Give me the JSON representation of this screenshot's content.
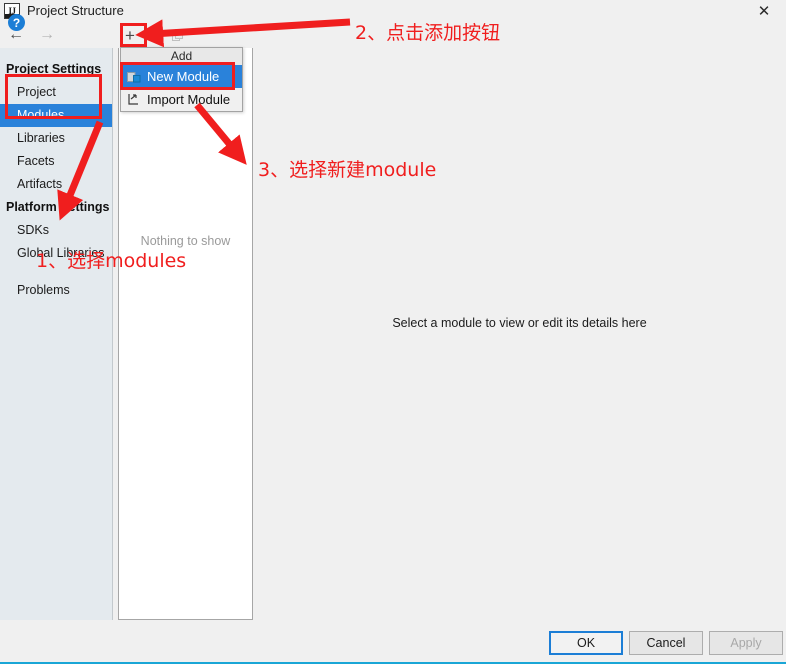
{
  "window": {
    "title": "Project Structure",
    "app_icon": "intellij-idea-icon",
    "close_label": "✕"
  },
  "nav": {
    "back_label": "←",
    "forward_label": "→"
  },
  "sidebar": {
    "groups": [
      {
        "label": "Project Settings",
        "items": [
          {
            "label": "Project",
            "selected": false
          },
          {
            "label": "Modules",
            "selected": true
          },
          {
            "label": "Libraries",
            "selected": false
          },
          {
            "label": "Facets",
            "selected": false
          },
          {
            "label": "Artifacts",
            "selected": false
          }
        ]
      },
      {
        "label": "Platform Settings",
        "items": [
          {
            "label": "SDKs",
            "selected": false
          },
          {
            "label": "Global Libraries",
            "selected": false
          }
        ]
      }
    ],
    "problems": "Problems"
  },
  "toolbar": {
    "add_label": "+",
    "remove_label": "−",
    "copy_label": "copy-icon"
  },
  "menu": {
    "header": "Add",
    "items": [
      {
        "label": "New Module",
        "icon": "module-icon",
        "active": true
      },
      {
        "label": "Import Module",
        "icon": "import-module-icon",
        "active": false
      }
    ]
  },
  "module_list": {
    "empty_text": "Nothing to show"
  },
  "detail": {
    "message": "Select a module to view or edit its details here"
  },
  "footer": {
    "help_label": "?",
    "ok_label": "OK",
    "cancel_label": "Cancel",
    "apply_label": "Apply"
  },
  "annotations": {
    "accent_color": "#f01e1e",
    "step1": "1、选择modules",
    "step2": "2、点击添加按钮",
    "step3": "3、选择新建module"
  }
}
